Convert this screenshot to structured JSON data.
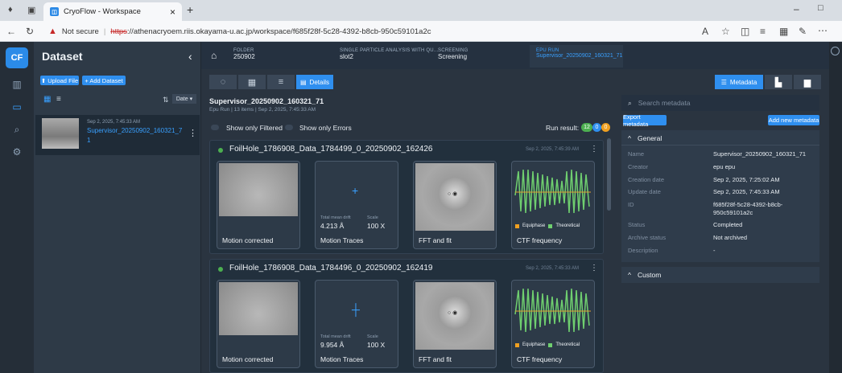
{
  "browser": {
    "tab_title": "CryoFlow - Workspace",
    "not_secure": "Not secure",
    "url_scheme": "https",
    "url_rest": "://athenacryoem.riis.okayama-u.ac.jp/workspace/f685f28f-5c28-4392-b8cb-950c59101a2c",
    "new_tab": "+",
    "close_tab": "×"
  },
  "app": {
    "logo": "CF",
    "panel_title": "Dataset",
    "collapse": "‹",
    "upload_label": "⬆ Upload File",
    "add_dataset_label": "+ Add Dataset",
    "sort_label": "Date",
    "dataset_item": {
      "date": "Sep 2, 2025, 7:45:33 AM",
      "name": "Supervisor_20250902_160321_7",
      "suffix": "1"
    }
  },
  "breadcrumb": [
    {
      "label": "FOLDER",
      "value": "250902"
    },
    {
      "label": "SINGLE PARTICLE ANALYSIS WITH QU...",
      "value": "slot2"
    },
    {
      "label": "SCREENING",
      "value": "Screening"
    },
    {
      "label": "EPU RUN",
      "value": "Supervisor_20250902_160321_71"
    }
  ],
  "view": {
    "details_label": "Details"
  },
  "run": {
    "title": "Supervisor_20250902_160321_71",
    "subtitle": "Epu Run  |  13 items  |  Sep 2, 2025, 7:45:33 AM",
    "filter_label": "Show only Filtered",
    "errors_label": "Show only Errors",
    "result_label": "Run result:",
    "badge_green": "12",
    "badge_blue": "0",
    "badge_orange": "0"
  },
  "items": [
    {
      "name": "FoilHole_1786908_Data_1784499_0_20250902_162426",
      "date": "Sep 2, 2025, 7:45:39 AM",
      "drift_label": "Total mean drift",
      "drift": "4.213 Å",
      "scale_label": "Scale",
      "scale": "100 X",
      "captions": [
        "Motion corrected",
        "Motion Traces",
        "FFT and fit",
        "CTF frequency"
      ],
      "legend": [
        "Equiphase",
        "Theoretical"
      ]
    },
    {
      "name": "FoilHole_1786908_Data_1784496_0_20250902_162419",
      "date": "Sep 2, 2025, 7:45:33 AM",
      "drift_label": "Total mean drift",
      "drift": "9.954 Å",
      "scale_label": "Scale",
      "scale": "100 X",
      "captions": [
        "Motion corrected",
        "Motion Traces",
        "FFT and fit",
        "CTF frequency"
      ],
      "legend": [
        "Equiphase",
        "Theoretical"
      ]
    }
  ],
  "metadata": {
    "tab_label": "Metadata",
    "search_placeholder": "Search metadata",
    "export_label": "Export metadata",
    "add_label": "Add new metadata",
    "general_label": "General",
    "custom_label": "Custom",
    "rows": [
      {
        "key": "Name",
        "value": "Supervisor_20250902_160321_71"
      },
      {
        "key": "Creator",
        "value": "epu epu"
      },
      {
        "key": "Creation date",
        "value": "Sep 2, 2025, 7:25:02 AM"
      },
      {
        "key": "Update date",
        "value": "Sep 2, 2025, 7:45:33 AM"
      },
      {
        "key": "ID",
        "value": "f685f28f-5c28-4392-b8cb-950c59101a2c"
      },
      {
        "key": "Status",
        "value": "Completed"
      },
      {
        "key": "Archive status",
        "value": "Not archived"
      },
      {
        "key": "Description",
        "value": "-"
      }
    ]
  }
}
